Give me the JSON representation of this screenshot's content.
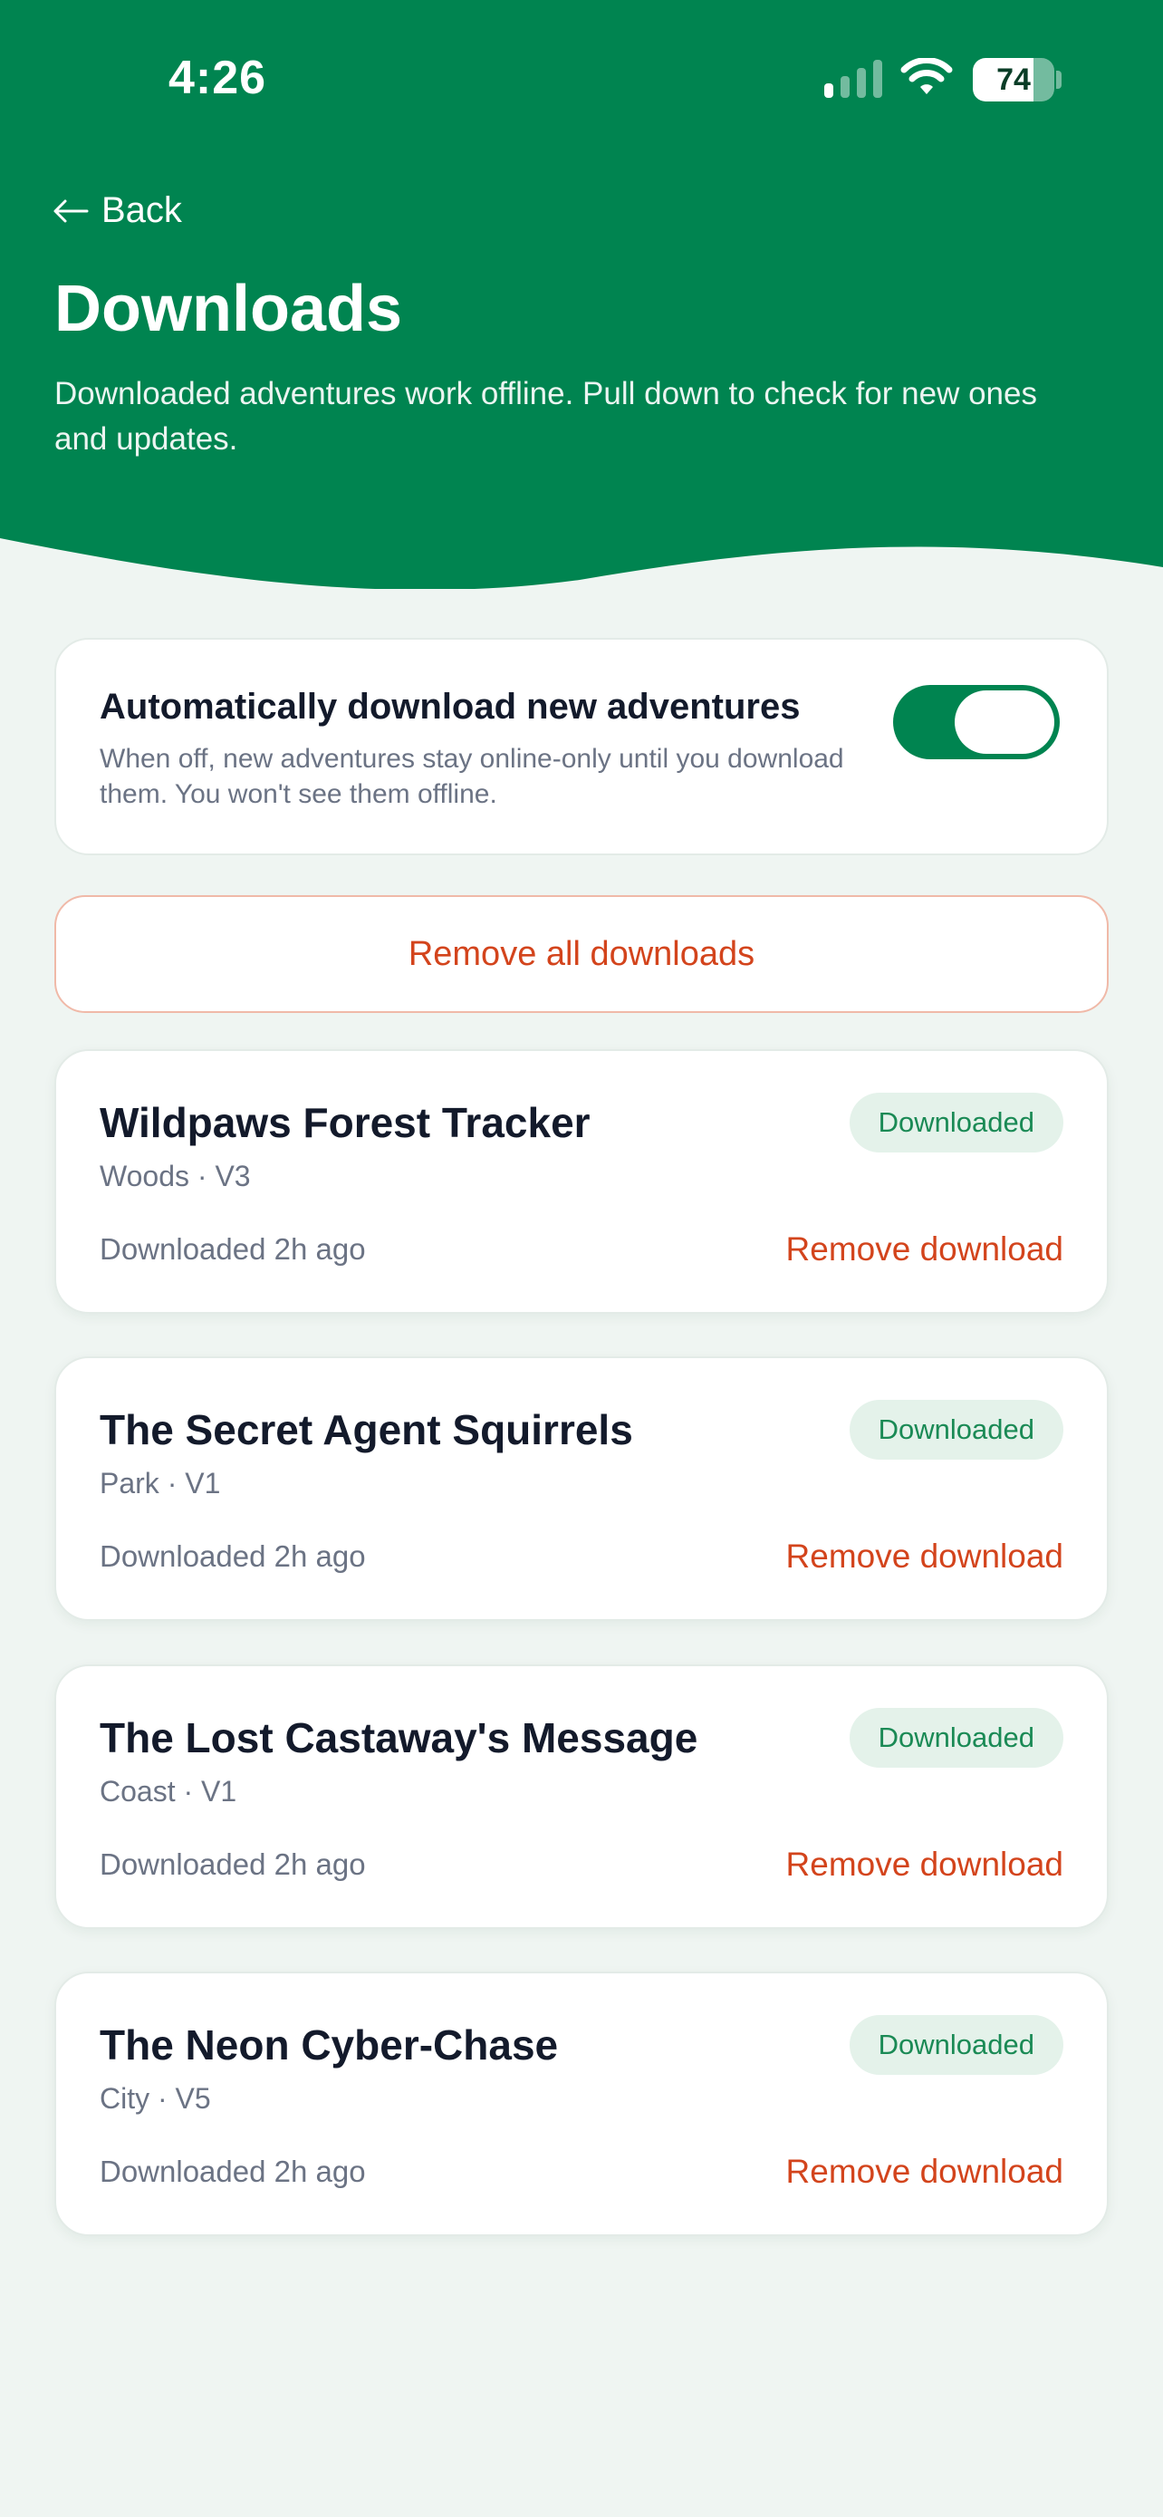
{
  "status": {
    "time": "4:26",
    "battery": "74",
    "battery_level": 0.74
  },
  "header": {
    "back_label": "Back",
    "title": "Downloads",
    "subtitle": "Downloaded adventures work offline. Pull down to check for new ones and updates."
  },
  "settings": {
    "auto_download_title": "Automatically download new adventures",
    "auto_download_desc": "When off, new adventures stay online-only until you download them. You won't see them offline.",
    "auto_download_on": true
  },
  "remove_all_label": "Remove all downloads",
  "adventures": [
    {
      "title": "Wildpaws Forest Tracker",
      "meta": "Woods · V3",
      "badge": "Downloaded",
      "time": "Downloaded 2h ago",
      "remove_label": "Remove download"
    },
    {
      "title": "The Secret Agent Squirrels",
      "meta": "Park · V1",
      "badge": "Downloaded",
      "time": "Downloaded 2h ago",
      "remove_label": "Remove download"
    },
    {
      "title": "The Lost Castaway's Message",
      "meta": "Coast · V1",
      "badge": "Downloaded",
      "time": "Downloaded 2h ago",
      "remove_label": "Remove download"
    },
    {
      "title": "The Neon Cyber-Chase",
      "meta": "City · V5",
      "badge": "Downloaded",
      "time": "Downloaded 2h ago",
      "remove_label": "Remove download"
    }
  ],
  "colors": {
    "brand": "#008450",
    "danger": "#d3441c",
    "background": "#eff5f2",
    "badge_bg": "#e4f2ea"
  },
  "icons": {
    "signal": "cellular-signal-icon",
    "wifi": "wifi-icon",
    "battery": "battery-icon",
    "back": "arrow-left-icon"
  }
}
